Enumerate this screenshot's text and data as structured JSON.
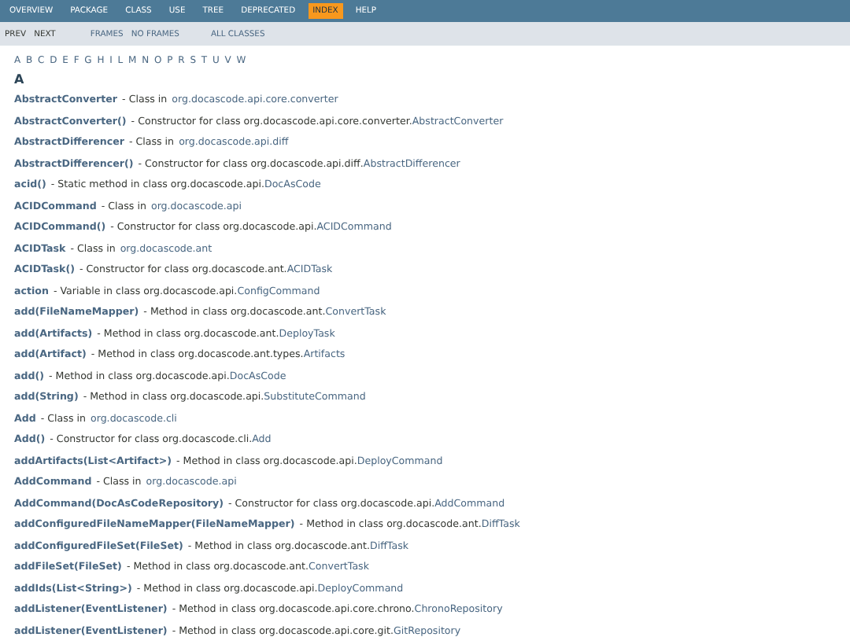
{
  "top_nav": [
    {
      "label": "OVERVIEW",
      "selected": false
    },
    {
      "label": "PACKAGE",
      "selected": false
    },
    {
      "label": "CLASS",
      "selected": false
    },
    {
      "label": "USE",
      "selected": false
    },
    {
      "label": "TREE",
      "selected": false
    },
    {
      "label": "DEPRECATED",
      "selected": false
    },
    {
      "label": "INDEX",
      "selected": true
    },
    {
      "label": "HELP",
      "selected": false
    }
  ],
  "sub_nav": {
    "left": [
      "PREV",
      "NEXT"
    ],
    "middle": [
      "FRAMES",
      "NO FRAMES"
    ],
    "right": [
      "ALL CLASSES"
    ]
  },
  "letters": [
    "A",
    "B",
    "C",
    "D",
    "E",
    "F",
    "G",
    "H",
    "I",
    "L",
    "M",
    "N",
    "O",
    "P",
    "R",
    "S",
    "T",
    "U",
    "V",
    "W"
  ],
  "section_heading": "A",
  "entries": [
    {
      "name": "AbstractConverter",
      "description": "- Class in",
      "link": "org.docascode.api.core.converter"
    },
    {
      "name": "AbstractConverter()",
      "description": "- Constructor for class org.docascode.api.core.converter.",
      "link": "AbstractConverter"
    },
    {
      "name": "AbstractDifferencer",
      "description": "- Class in",
      "link": "org.docascode.api.diff"
    },
    {
      "name": "AbstractDifferencer()",
      "description": "- Constructor for class org.docascode.api.diff.",
      "link": "AbstractDifferencer"
    },
    {
      "name": "acid()",
      "description": "- Static method in class org.docascode.api.",
      "link": "DocAsCode"
    },
    {
      "name": "ACIDCommand",
      "description": "- Class in",
      "link": "org.docascode.api"
    },
    {
      "name": "ACIDCommand()",
      "description": "- Constructor for class org.docascode.api.",
      "link": "ACIDCommand"
    },
    {
      "name": "ACIDTask",
      "description": "- Class in",
      "link": "org.docascode.ant"
    },
    {
      "name": "ACIDTask()",
      "description": "- Constructor for class org.docascode.ant.",
      "link": "ACIDTask"
    },
    {
      "name": "action",
      "description": "- Variable in class org.docascode.api.",
      "link": "ConfigCommand"
    },
    {
      "name": "add(FileNameMapper)",
      "description": "- Method in class org.docascode.ant.",
      "link": "ConvertTask"
    },
    {
      "name": "add(Artifacts)",
      "description": "- Method in class org.docascode.ant.",
      "link": "DeployTask"
    },
    {
      "name": "add(Artifact)",
      "description": "- Method in class org.docascode.ant.types.",
      "link": "Artifacts"
    },
    {
      "name": "add()",
      "description": "- Method in class org.docascode.api.",
      "link": "DocAsCode"
    },
    {
      "name": "add(String)",
      "description": "- Method in class org.docascode.api.",
      "link": "SubstituteCommand"
    },
    {
      "name": "Add",
      "description": "- Class in",
      "link": "org.docascode.cli"
    },
    {
      "name": "Add()",
      "description": "- Constructor for class org.docascode.cli.",
      "link": "Add"
    },
    {
      "name": "addArtifacts(List<Artifact>)",
      "description": "- Method in class org.docascode.api.",
      "link": "DeployCommand"
    },
    {
      "name": "AddCommand",
      "description": "- Class in",
      "link": "org.docascode.api"
    },
    {
      "name": "AddCommand(DocAsCodeRepository)",
      "description": "- Constructor for class org.docascode.api.",
      "link": "AddCommand"
    },
    {
      "name": "addConfiguredFileNameMapper(FileNameMapper)",
      "description": "- Method in class org.docascode.ant.",
      "link": "DiffTask"
    },
    {
      "name": "addConfiguredFileSet(FileSet)",
      "description": "- Method in class org.docascode.ant.",
      "link": "DiffTask"
    },
    {
      "name": "addFileSet(FileSet)",
      "description": "- Method in class org.docascode.ant.",
      "link": "ConvertTask"
    },
    {
      "name": "addIds(List<String>)",
      "description": "- Method in class org.docascode.api.",
      "link": "DeployCommand"
    },
    {
      "name": "addListener(EventListener)",
      "description": "- Method in class org.docascode.api.core.chrono.",
      "link": "ChronoRepository"
    },
    {
      "name": "addListener(EventListener)",
      "description": "- Method in class org.docascode.api.core.git.",
      "link": "GitRepository"
    }
  ]
}
